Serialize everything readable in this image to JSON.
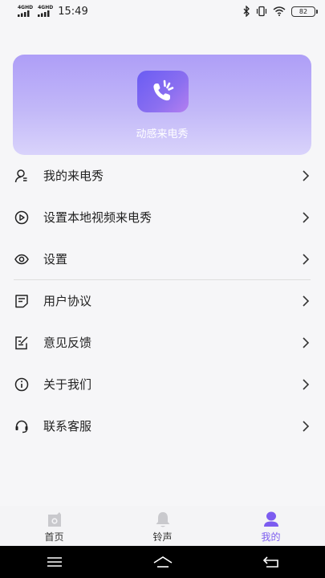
{
  "status_bar": {
    "network_1": "4G",
    "network_2": "4G",
    "time": "15:49",
    "battery": "82"
  },
  "profile_card": {
    "app_name": "动感来电秀",
    "icon": "phone-ring-icon"
  },
  "menu": {
    "items": [
      {
        "label": "我的来电秀",
        "icon": "user-icon"
      },
      {
        "label": "设置本地视频来电秀",
        "icon": "play-circle-icon"
      },
      {
        "label": "设置",
        "icon": "eye-settings-icon"
      },
      {
        "label": "用户协议",
        "icon": "document-icon"
      },
      {
        "label": "意见反馈",
        "icon": "edit-icon"
      },
      {
        "label": "关于我们",
        "icon": "info-icon"
      },
      {
        "label": "联系客服",
        "icon": "headset-icon"
      }
    ]
  },
  "tab_bar": {
    "tabs": [
      {
        "label": "首页",
        "icon": "home-camera-icon"
      },
      {
        "label": "铃声",
        "icon": "bell-icon"
      },
      {
        "label": "我的",
        "icon": "profile-icon"
      }
    ],
    "active_color": "#7c5cf0"
  },
  "nav_bar": {
    "buttons": [
      "menu-icon",
      "home-icon",
      "back-icon"
    ]
  }
}
